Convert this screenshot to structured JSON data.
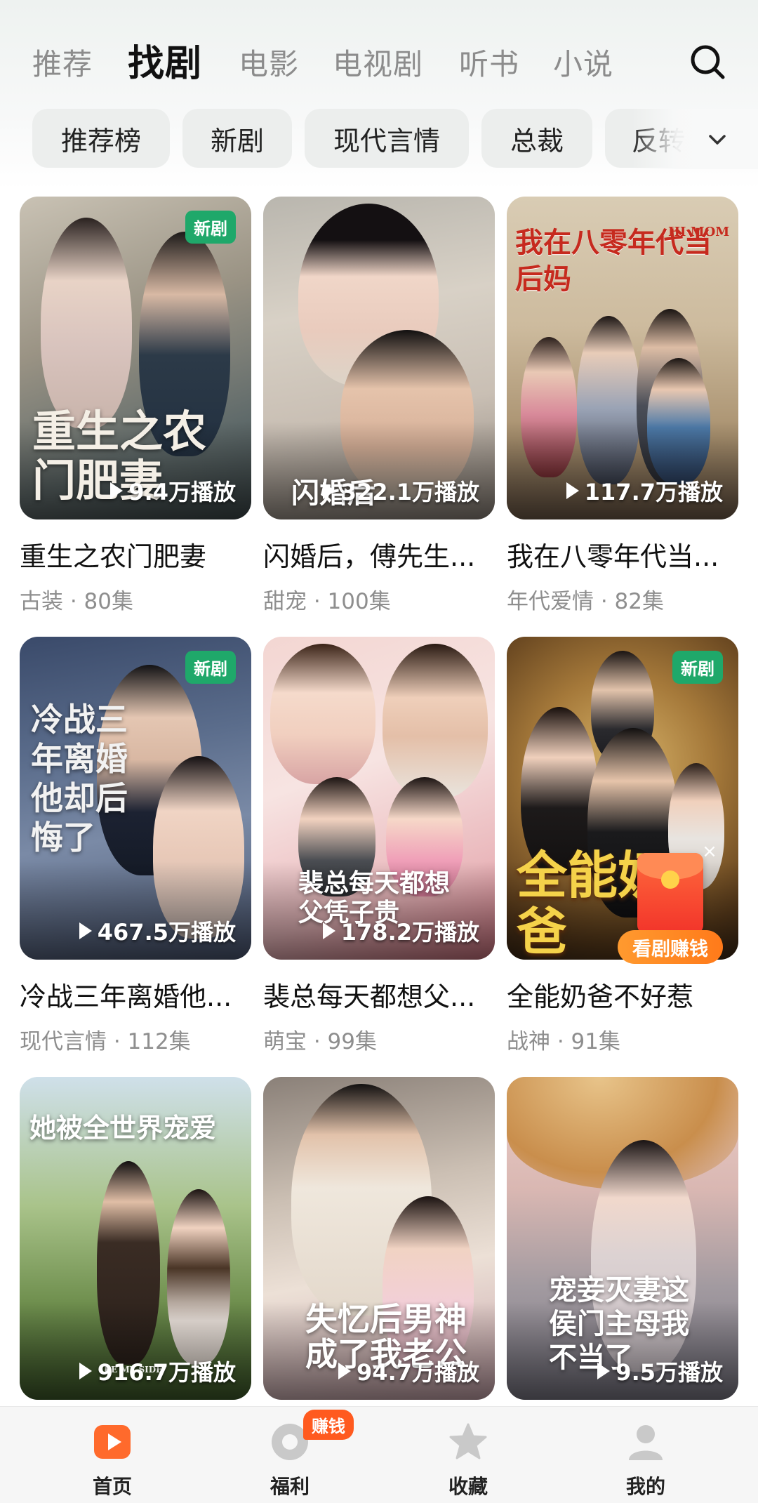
{
  "top_tabs": [
    "推荐",
    "找剧",
    "电影",
    "电视剧",
    "听书",
    "小说"
  ],
  "active_top_tab": "找剧",
  "chips": [
    "推荐榜",
    "新剧",
    "现代言情",
    "总裁",
    "反转"
  ],
  "cards": [
    {
      "title": "重生之农门肥妻",
      "meta": "古装 · 80集",
      "plays": "9.4万播放",
      "badge": "新剧",
      "poster_text": "重生之农门肥妻"
    },
    {
      "title": "闪婚后，傅先生...",
      "meta": "甜宠 · 100集",
      "plays": "322.1万播放",
      "badge": "",
      "poster_text": "闪婚后"
    },
    {
      "title": "我在八零年代当...",
      "meta": "年代爱情 · 82集",
      "plays": "117.7万播放",
      "badge": "",
      "poster_text": "我在八零年代当后妈",
      "poster_subtext": "HI MOM"
    },
    {
      "title": "冷战三年离婚他...",
      "meta": "现代言情 · 112集",
      "plays": "467.5万播放",
      "badge": "新剧",
      "poster_text": "冷战三年离婚他却后悔了"
    },
    {
      "title": "裴总每天都想父...",
      "meta": "萌宝 · 99集",
      "plays": "178.2万播放",
      "badge": "",
      "poster_text": "裴总每天都想父凭子贵"
    },
    {
      "title": "全能奶爸不好惹",
      "meta": "战神 · 91集",
      "plays": "",
      "badge": "新剧",
      "poster_text": "全能奶爸"
    },
    {
      "title": "",
      "meta": "",
      "plays": "916.7万播放",
      "badge": "",
      "poster_text": "她被全世界宠爱",
      "poster_subtext": "BE MY SIDE"
    },
    {
      "title": "",
      "meta": "",
      "plays": "94.7万播放",
      "badge": "",
      "poster_text": "失忆后男神成了我老公"
    },
    {
      "title": "",
      "meta": "",
      "plays": "9.5万播放",
      "badge": "",
      "poster_text": "宠妾灭妻这侯门主母我不当了"
    }
  ],
  "red_packet": {
    "label": "看剧赚钱",
    "close": "×"
  },
  "bottom_nav": [
    {
      "label": "首页",
      "icon": "home-play-icon",
      "active": true
    },
    {
      "label": "福利",
      "icon": "gift-coin-icon",
      "badge": "赚钱"
    },
    {
      "label": "收藏",
      "icon": "star-icon"
    },
    {
      "label": "我的",
      "icon": "profile-icon"
    }
  ],
  "colors": {
    "accent": "#ff6a2c",
    "new_badge": "#1fa86a",
    "nav_bg": "#f6f6f6"
  }
}
